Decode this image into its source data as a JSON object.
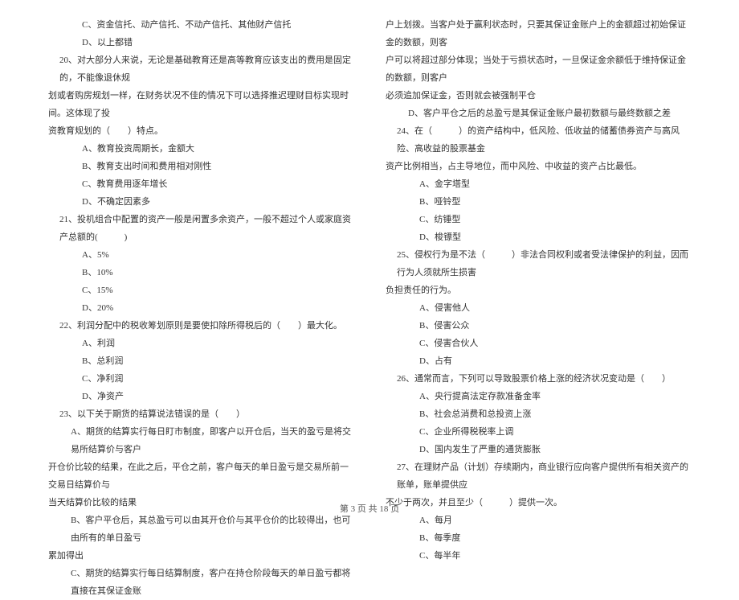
{
  "leftColumn": {
    "lines": [
      {
        "text": "C、资金信托、动产信托、不动产信托、其他财产信托",
        "cls": "indent-2"
      },
      {
        "text": "D、以上都错",
        "cls": "indent-2"
      },
      {
        "text": "20、对大部分人来说，无论是基础教育还是高等教育应该支出的费用是固定的，不能像退休规",
        "cls": "q-start"
      },
      {
        "text": "划或者购房规划一样，在财务状况不佳的情况下可以选择推迟理财目标实现时间。这体现了投",
        "cls": ""
      },
      {
        "text": "资教育规划的（　　）特点。",
        "cls": ""
      },
      {
        "text": "A、教育投资周期长，金额大",
        "cls": "indent-2"
      },
      {
        "text": "B、教育支出时间和费用相对刚性",
        "cls": "indent-2"
      },
      {
        "text": "C、教育费用逐年增长",
        "cls": "indent-2"
      },
      {
        "text": "D、不确定因素多",
        "cls": "indent-2"
      },
      {
        "text": "21、投机组合中配置的资产一般是闲置多余资产，一般不超过个人或家庭资产总额的(　　　)",
        "cls": "q-start"
      },
      {
        "text": "A、5%",
        "cls": "indent-2"
      },
      {
        "text": "B、10%",
        "cls": "indent-2"
      },
      {
        "text": "C、15%",
        "cls": "indent-2"
      },
      {
        "text": "D、20%",
        "cls": "indent-2"
      },
      {
        "text": "22、利润分配中的税收筹划原则是要使扣除所得税后的（　　）最大化。",
        "cls": "q-start"
      },
      {
        "text": "A、利润",
        "cls": "indent-2"
      },
      {
        "text": "B、总利润",
        "cls": "indent-2"
      },
      {
        "text": "C、净利润",
        "cls": "indent-2"
      },
      {
        "text": "D、净资产",
        "cls": "indent-2"
      },
      {
        "text": "23、以下关于期货的结算说法错误的是（　　）",
        "cls": "q-start"
      },
      {
        "text": "A、期货的结算实行每日盯市制度，即客户以开仓后，当天的盈亏是将交易所结算价与客户",
        "cls": "indent-1"
      },
      {
        "text": "开仓价比较的结果，在此之后，平仓之前，客户每天的单日盈亏是交易所前一交易日结算价与",
        "cls": ""
      },
      {
        "text": "当天结算价比较的结果",
        "cls": ""
      },
      {
        "text": "B、客户平仓后，其总盈亏可以由其开仓价与其平仓价的比较得出，也可由所有的单日盈亏",
        "cls": "indent-1"
      },
      {
        "text": "累加得出",
        "cls": ""
      },
      {
        "text": "C、期货的结算实行每日结算制度，客户在持仓阶段每天的单日盈亏都将直接在其保证金账",
        "cls": "indent-1"
      }
    ]
  },
  "rightColumn": {
    "lines": [
      {
        "text": "户上划拨。当客户处于赢利状态时，只要其保证金账户上的金额超过初始保证金的数额，则客",
        "cls": ""
      },
      {
        "text": "户可以将超过部分体现；当处于亏损状态时，一旦保证金余额低于维持保证金的数额，则客户",
        "cls": ""
      },
      {
        "text": "必须追加保证金，否则就会被强制平仓",
        "cls": ""
      },
      {
        "text": "D、客户平仓之后的总盈亏是其保证金账户最初数额与最终数额之差",
        "cls": "indent-1"
      },
      {
        "text": "24、在（　　　）的资产结构中，低风险、低收益的储蓄债券资产与高风险、高收益的股票基金",
        "cls": "q-start"
      },
      {
        "text": "资产比例相当，占主导地位，而中风险、中收益的资产占比最低。",
        "cls": ""
      },
      {
        "text": "A、金字塔型",
        "cls": "indent-2"
      },
      {
        "text": "B、哑铃型",
        "cls": "indent-2"
      },
      {
        "text": "C、纺锤型",
        "cls": "indent-2"
      },
      {
        "text": "D、梭镖型",
        "cls": "indent-2"
      },
      {
        "text": "25、侵权行为是不法（　　　）非法合同权利或者受法律保护的利益，因而行为人须就所生损害",
        "cls": "q-start"
      },
      {
        "text": "负担责任的行为。",
        "cls": ""
      },
      {
        "text": "A、侵害他人",
        "cls": "indent-2"
      },
      {
        "text": "B、侵害公众",
        "cls": "indent-2"
      },
      {
        "text": "C、侵害合伙人",
        "cls": "indent-2"
      },
      {
        "text": "D、占有",
        "cls": "indent-2"
      },
      {
        "text": "26、通常而言，下列可以导致股票价格上涨的经济状况变动是（　　）",
        "cls": "q-start"
      },
      {
        "text": "A、央行提高法定存款准备金率",
        "cls": "indent-2"
      },
      {
        "text": "B、社会总消费和总投资上涨",
        "cls": "indent-2"
      },
      {
        "text": "C、企业所得税税率上调",
        "cls": "indent-2"
      },
      {
        "text": "D、国内发生了严重的通货膨胀",
        "cls": "indent-2"
      },
      {
        "text": "27、在理财产品（计划）存续期内，商业银行应向客户提供所有相关资产的账单，账单提供应",
        "cls": "q-start"
      },
      {
        "text": "不少于两次，并且至少（　　　）提供一次。",
        "cls": ""
      },
      {
        "text": "A、每月",
        "cls": "indent-2"
      },
      {
        "text": "B、每季度",
        "cls": "indent-2"
      },
      {
        "text": "C、每半年",
        "cls": "indent-2"
      }
    ]
  },
  "footer": {
    "text": "第 3 页 共 18 页"
  }
}
